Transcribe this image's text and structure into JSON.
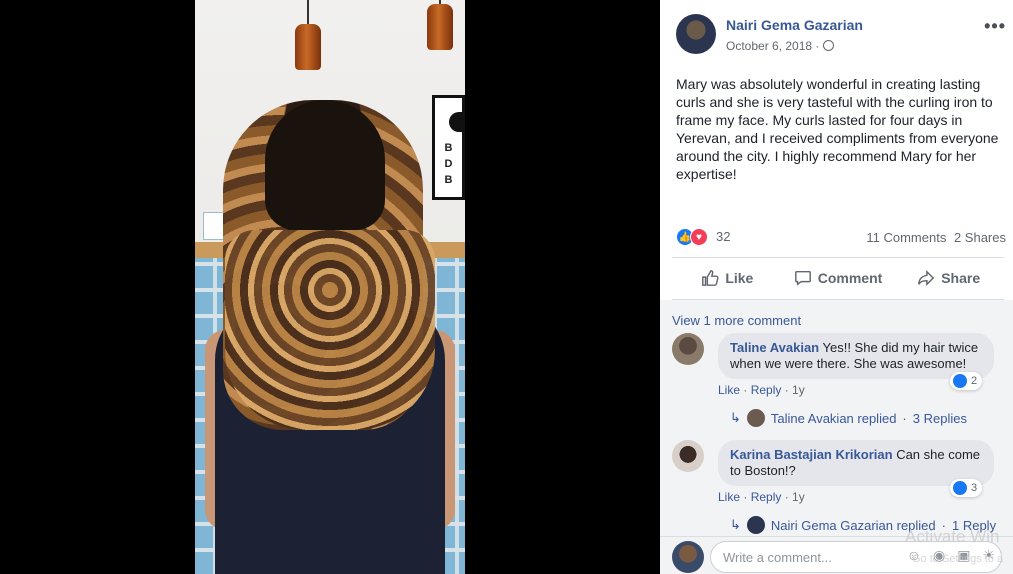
{
  "post": {
    "author": "Nairi Gema Gazarian",
    "date": "October 6, 2018 ·",
    "more_label": "•••",
    "text": "Mary was absolutely wonderful in creating lasting curls and she is very tasteful with the curling iron to frame my face. My curls lasted for four days in Yerevan, and I received compliments from everyone around the city. I highly recommend Mary for her expertise!",
    "reaction_count": "32",
    "comments_count": "11 Comments",
    "shares_count": "2 Shares"
  },
  "photo": {
    "poster_lines": [
      "B",
      "D",
      "B"
    ]
  },
  "actions": {
    "like": "Like",
    "comment": "Comment",
    "share": "Share"
  },
  "comments": {
    "view_more": "View 1 more comment",
    "items": [
      {
        "name": "Taline Avakian",
        "text": "Yes!! She did my hair twice when we were there. She was awesome!",
        "reaction_count": "2",
        "like": "Like",
        "reply": "Reply",
        "time": "1y",
        "reply_summary_name": "Taline Avakian replied",
        "reply_summary_count": "3 Replies"
      },
      {
        "name": "Karina Bastajian Krikorian",
        "text": "Can she come to Boston!?",
        "reaction_count": "3",
        "like": "Like",
        "reply": "Reply",
        "time": "1y",
        "reply_summary_name": "Nairi Gema Gazarian replied",
        "reply_summary_count": "1 Reply"
      }
    ]
  },
  "composer": {
    "placeholder": "Write a comment..."
  },
  "overlay": {
    "watermark_line1": "Activate Win",
    "watermark_line2": "Go to Settings to a"
  },
  "icons": [
    "globe-icon",
    "like-icon",
    "love-icon",
    "comment-icon",
    "share-icon",
    "reply-arrow-icon",
    "emoji-icon",
    "camera-icon",
    "gif-icon",
    "sticker-icon"
  ],
  "colors": {
    "link": "#385898",
    "like_blue": "#1877f2",
    "love_red": "#f33e58",
    "comment_bg": "#f2f3f5"
  }
}
